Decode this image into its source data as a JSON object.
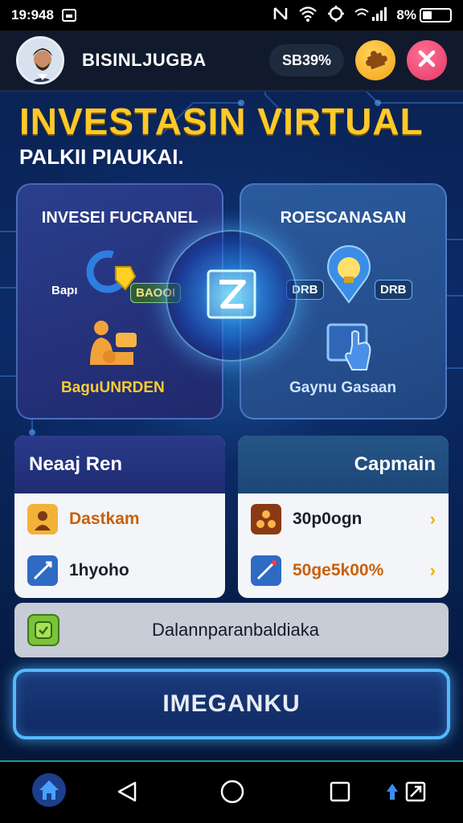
{
  "status_bar": {
    "time": "19:948",
    "battery_text": "8%",
    "battery_level": 0.35
  },
  "header": {
    "title": "BISINLJUGBA",
    "pill_value": "SB39%"
  },
  "hero": {
    "title": "INVESTASIN VIRTUAL",
    "subtitle": "PALKII PIAUKAI."
  },
  "cards": {
    "left": {
      "title": "INVESEI FUCRANEL",
      "tag_left": "Bapı",
      "tag_right": "BAOOI",
      "label": "BaguUNRDEN"
    },
    "right": {
      "title": "ROESCANASAN",
      "tag_left": "DRB",
      "tag_right": "DRB",
      "label": "Gaynu Gasaan"
    }
  },
  "panels": {
    "left": {
      "title": "Neaaj Ren",
      "rows": [
        {
          "text": "Dastkam",
          "icon": "person-icon"
        },
        {
          "text": "1hyoho",
          "icon": "chart-line-icon"
        }
      ]
    },
    "right": {
      "title": "Capmain",
      "rows": [
        {
          "text": "30p0ogn",
          "icon": "network-icon"
        },
        {
          "text": "50ge5k00%",
          "icon": "chart-line-icon"
        }
      ]
    }
  },
  "notice": {
    "text": "Dalannparanbaldiaka"
  },
  "cta": {
    "label": "IMEGANKU"
  },
  "colors": {
    "accent_yellow": "#ffc928",
    "cta_border": "#55b8ff",
    "close_pink": "#e23a64",
    "orange": "#f5a316"
  }
}
